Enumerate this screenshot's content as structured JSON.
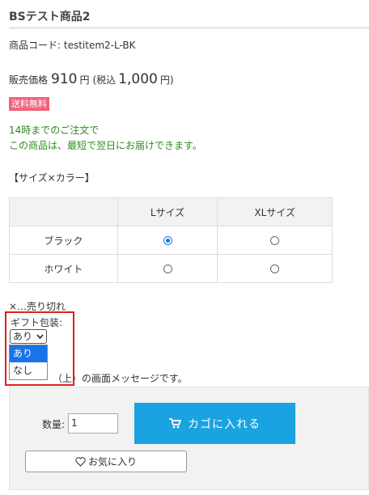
{
  "product": {
    "title": "BSテスト商品2",
    "code": "商品コード: testitem2-L-BK",
    "price_label": "販売価格",
    "price": "910",
    "yen": "円",
    "tax_in_label": "(税込",
    "tax_in_price": "1,000",
    "yen_close": "円)",
    "free_shipping_badge": "送料無料",
    "delivery_line1": "14時までのご注文で",
    "delivery_line2": "この商品は、最短で翌日にお届けできます。"
  },
  "variants": {
    "title": "【サイズ×カラー】",
    "columns": [
      "Lサイズ",
      "XLサイズ"
    ],
    "rows": [
      {
        "label": "ブラック",
        "selected": [
          true,
          false
        ]
      },
      {
        "label": "ホワイト",
        "selected": [
          false,
          false
        ]
      }
    ],
    "soldout_note": "×…売り切れ"
  },
  "gift": {
    "label": "ギフト包装:",
    "selected": "あり",
    "options": [
      "あり",
      "なし"
    ]
  },
  "screen_message": "（上）の画面メッセージです。",
  "cart": {
    "qty_label": "数量:",
    "qty_value": "1",
    "add_to_cart": "カゴに入れる",
    "favorite": "お気に入り"
  },
  "colors": {
    "accent_blue": "#1aa3e0",
    "badge_pink": "#f0637c",
    "delivery_green": "#2e8b1e",
    "highlight_red": "#e02020",
    "select_blue": "#1a73e8"
  }
}
